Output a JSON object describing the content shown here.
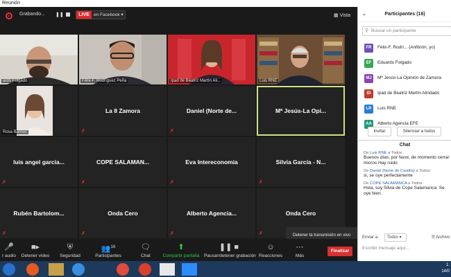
{
  "window": {
    "title": "Reunión"
  },
  "recording": {
    "label": "Grabando...",
    "live": "LIVE",
    "destination": "en Facebook",
    "view": "Vista"
  },
  "tiles": [
    {
      "name": "",
      "caption": "ardo Folgado",
      "video": "person-1"
    },
    {
      "name": "",
      "caption": "Félix-F. Rodríguez Peña",
      "video": "person-2"
    },
    {
      "name": "",
      "caption": "Ipad de Beatriz Martín Ali...",
      "video": "person-3"
    },
    {
      "name": "",
      "caption": "Luis RNE",
      "video": "person-4"
    },
    {
      "name": "",
      "caption": "Rosa Barrios",
      "video": "person-5"
    },
    {
      "name": "La 8 Zamora",
      "caption": ""
    },
    {
      "name": "Daniel (Norte de...",
      "caption": ""
    },
    {
      "name": "Mª Jesús-La Opi...",
      "caption": "",
      "active": true
    },
    {
      "name": "luis angel garcia...",
      "caption": ""
    },
    {
      "name": "COPE SALAMAN...",
      "caption": ""
    },
    {
      "name": "Eva Intereconomia",
      "caption": ""
    },
    {
      "name": "Silvia García - N...",
      "caption": ""
    },
    {
      "name": "Rubén Bartolom...",
      "caption": ""
    },
    {
      "name": "Onda Cero",
      "caption": ""
    },
    {
      "name": "Alberto Agencia...",
      "caption": ""
    },
    {
      "name": "Onda Cero",
      "caption": ""
    }
  ],
  "toolbar": {
    "items": [
      {
        "label": "r audio",
        "icon": "microphone-icon"
      },
      {
        "label": "Detener video",
        "icon": "camera-icon"
      },
      {
        "label": "Seguridad",
        "icon": "shield-icon"
      },
      {
        "label": "Participantes",
        "icon": "people-icon",
        "count": "16"
      },
      {
        "label": "Chat",
        "icon": "chat-icon"
      },
      {
        "label": "Compartir pantalla",
        "icon": "share-screen-icon"
      },
      {
        "label": "Pausar/detener grabación",
        "icon": "pause-icon"
      },
      {
        "label": "Reacciones",
        "icon": "smile-icon"
      },
      {
        "label": "Más",
        "icon": "more-icon"
      }
    ],
    "end": "Finalizar",
    "tooltip": "Detener la transmisión en vivo"
  },
  "participants": {
    "title": "Participantes (16)",
    "search_placeholder": "Buscar un participante",
    "list": [
      {
        "initials": "FR",
        "name": "Félix-F. Rodrí... (Anfitrión, yo)",
        "color": "#6f4fb5"
      },
      {
        "initials": "EF",
        "name": "Eduardo Folgado",
        "color": "#3aa655"
      },
      {
        "initials": "MJ",
        "name": "Mª Jesús-La Opinión de Zamora",
        "color": "#8a44b8"
      },
      {
        "initials": "ID",
        "name": "Ipad de Beatriz Martín Alindado",
        "color": "#c23b2f"
      },
      {
        "initials": "LR",
        "name": "Luis RNE",
        "color": "#2b7bd6"
      },
      {
        "initials": "AA",
        "name": "Alberto Agencia EFE",
        "color": "#1f9a7a"
      }
    ],
    "invite": "Invitar",
    "mute_all": "Silenciar a todos"
  },
  "chat": {
    "title": "Chat",
    "messages": [
      {
        "from_prefix": "De ",
        "from": "Luis RNE",
        "to": " a Todos:",
        "text": "Buenos días, por favor, de momento cerrar micros Hay ruido"
      },
      {
        "from_prefix": "De ",
        "from": "Daniel (Norte de Castilla)",
        "to": " a Todos:",
        "text": "si, se oye perfectamente"
      },
      {
        "from_prefix": "De ",
        "from": "COPE SALAMANCA",
        "to": " a Todos:",
        "text": "Hola, soy Silvia de Cope Salamanca. Se oye bien."
      }
    ],
    "send_to_label": "Enviar a:",
    "send_to_value": "Todos",
    "file": "Archivo",
    "input_placeholder": "Escribir mensaje aquí..."
  },
  "clock": {
    "time": "1:",
    "date": "14/0"
  }
}
